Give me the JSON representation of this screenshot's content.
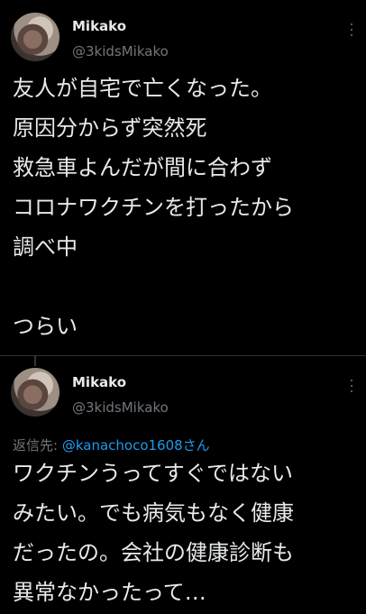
{
  "tweets": [
    {
      "name": "Mikako",
      "handle": "@3kidsMikako",
      "avatar_icon": "profile-photo",
      "text": "友人が自宅で亡くなった。\n原因分からず突然死\n救急車よんだが間に合わず\nコロナワクチンを打ったから\n調べ中\n\nつらい"
    },
    {
      "name": "Mikako",
      "handle": "@3kidsMikako",
      "avatar_icon": "profile-photo",
      "reply_prefix": "返信先: ",
      "reply_to": "@kanachoco1608さん",
      "text": "ワクチンうってすぐではない\nみたい。でも病気もなく健康\nだったの。会社の健康診断も\n異常なかったって…"
    }
  ],
  "colors": {
    "background": "#000000",
    "text": "#e7e9ea",
    "muted": "#71767b",
    "link": "#1d9bf0"
  }
}
